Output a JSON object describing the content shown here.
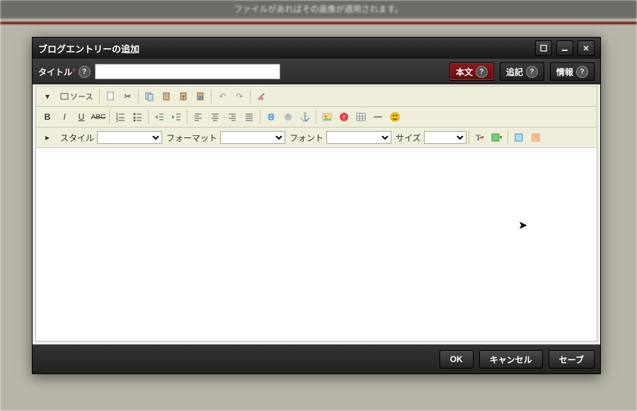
{
  "backdrop_text": "ファイルがあればその画像が適用されます。",
  "dialog": {
    "title": "ブログエントリーの追加",
    "title_label": "タイトル",
    "title_value": "",
    "tabs": {
      "body": "本文",
      "more": "追記",
      "info": "情報"
    }
  },
  "toolbar": {
    "source": "ソース",
    "style_label": "スタイル",
    "format_label": "フォーマット",
    "font_label": "フォント",
    "size_label": "サイズ"
  },
  "footer": {
    "ok": "OK",
    "cancel": "キャンセル",
    "save": "セーブ"
  }
}
